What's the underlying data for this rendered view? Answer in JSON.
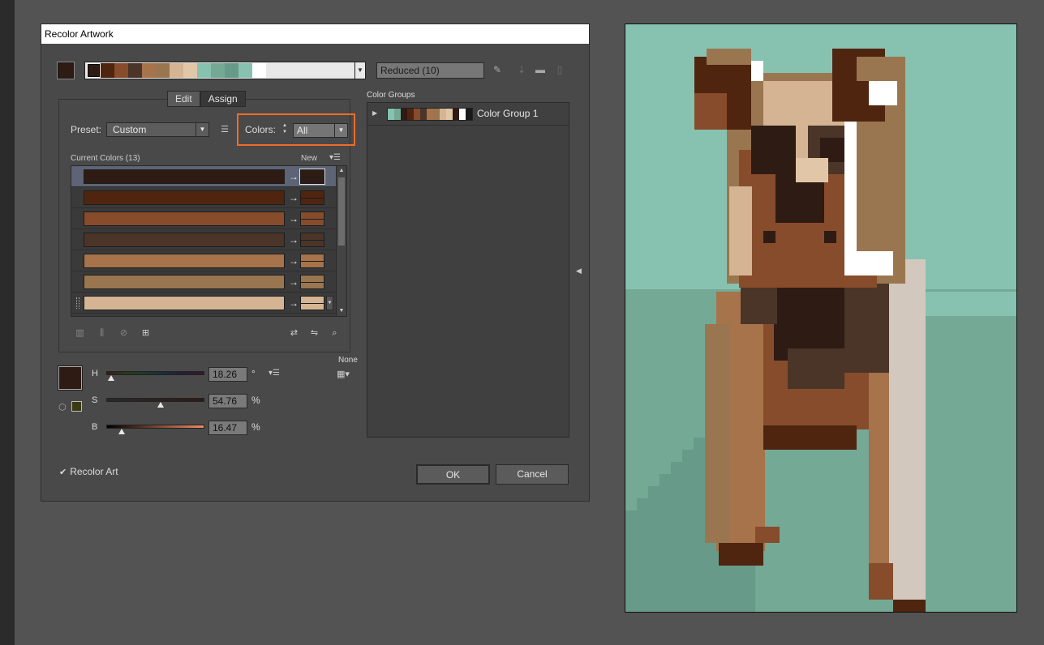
{
  "window": {
    "title": "Recolor Artwork"
  },
  "colors": {
    "c1": "#2e1b14",
    "c2": "#4f2510",
    "c3": "#874c2c",
    "c4": "#4a3528",
    "c5": "#a7734a",
    "c6": "#9a7650",
    "c7": "#d4b493",
    "c8": "#e1c7a8",
    "teal1": "#86c2af",
    "teal2": "#74a996",
    "teal3": "#679a88",
    "white": "#ffffff",
    "cream": "#d3c8bd",
    "highlight": "#f06c28"
  },
  "top": {
    "strip_colors": [
      "#2e1b14",
      "#4f2510",
      "#874c2c",
      "#4a3528",
      "#a7734a",
      "#9a7650",
      "#d4b493",
      "#e1c7a8",
      "#86c2af",
      "#74a996",
      "#679a88",
      "#86c2af",
      "#ffffff"
    ],
    "reduced_label": "Reduced (10)",
    "icons": [
      "eyedropper-icon",
      "save-group-icon",
      "folder-icon",
      "trash-icon"
    ]
  },
  "tabs": {
    "edit": "Edit",
    "assign": "Assign"
  },
  "preset": {
    "label": "Preset:",
    "value": "Custom"
  },
  "colors_control": {
    "label": "Colors:",
    "value": "All"
  },
  "current_colors": {
    "label": "Current Colors (13)",
    "new_label": "New",
    "rows": [
      {
        "current": "#2e1b14",
        "new": "#2e1b14",
        "selected": true
      },
      {
        "current": "#4f2510",
        "new": "#4f2510"
      },
      {
        "current": "#874c2c",
        "new": "#874c2c"
      },
      {
        "current": "#4a3528",
        "new": "#4a3528"
      },
      {
        "current": "#a7734a",
        "new": "#a7734a"
      },
      {
        "current": "#9a7650",
        "new": "#9a7650"
      },
      {
        "current": "#d4b493",
        "new": "#d4b493"
      },
      {
        "current": "#e1c7a8",
        "new": "#e1c7a8"
      }
    ]
  },
  "hsb": {
    "h": {
      "label": "H",
      "value": "18.26",
      "unit": "°",
      "fraction": 0.05
    },
    "s": {
      "label": "S",
      "value": "54.76",
      "unit": "%",
      "fraction": 0.55
    },
    "b": {
      "label": "B",
      "value": "16.47",
      "unit": "%",
      "fraction": 0.16
    },
    "none_label": "None"
  },
  "color_groups": {
    "label": "Color Groups",
    "groups": [
      {
        "name": "Color Group 1",
        "colors": [
          "#86c2af",
          "#74a996",
          "#2e1b14",
          "#4f2510",
          "#874c2c",
          "#4a3528",
          "#a7734a",
          "#9a7650",
          "#d4b493",
          "#e1c7a8",
          "#2e1b14",
          "#ffffff",
          "#1a1a1a"
        ]
      }
    ]
  },
  "footer": {
    "recolor_art": "Recolor Art",
    "ok": "OK",
    "cancel": "Cancel"
  }
}
